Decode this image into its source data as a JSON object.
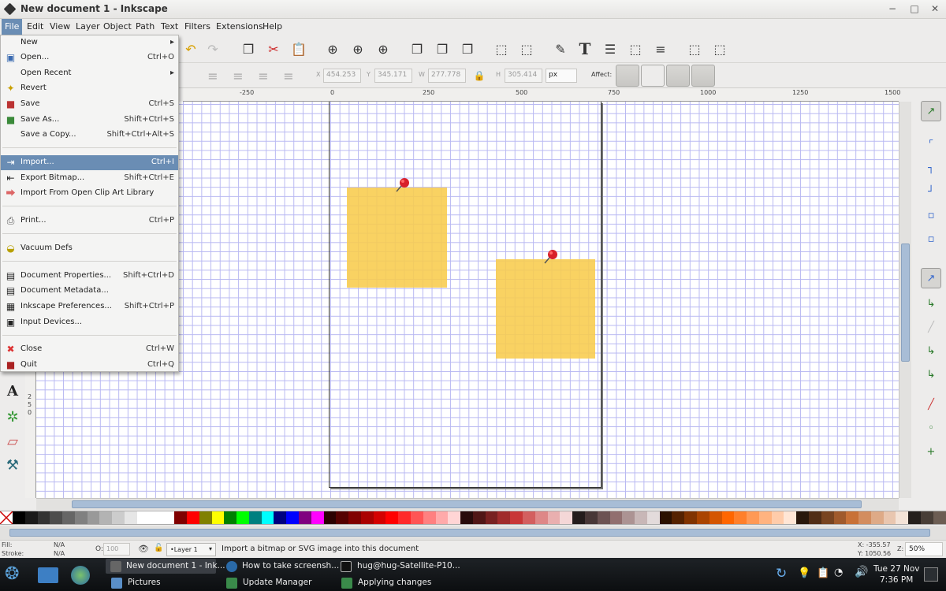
{
  "window": {
    "title": "New document 1 - Inkscape",
    "controls": [
      "−",
      "□",
      "✕"
    ]
  },
  "menubar": {
    "items": [
      "File",
      "Edit",
      "View",
      "Layer",
      "Object",
      "Path",
      "Text",
      "Filters",
      "Extensions",
      "Help"
    ]
  },
  "file_menu": {
    "items": [
      {
        "label": "New",
        "shortcut": "",
        "icon": "new-icon",
        "submenu": true
      },
      {
        "label": "Open...",
        "shortcut": "Ctrl+O",
        "icon": "open-icon"
      },
      {
        "label": "Open Recent",
        "shortcut": "",
        "icon": "",
        "submenu": true
      },
      {
        "label": "Revert",
        "shortcut": "",
        "icon": "revert-icon"
      },
      {
        "label": "Save",
        "shortcut": "Ctrl+S",
        "icon": "save-icon"
      },
      {
        "label": "Save As...",
        "shortcut": "Shift+Ctrl+S",
        "icon": "save-as-icon"
      },
      {
        "label": "Save a Copy...",
        "shortcut": "Shift+Ctrl+Alt+S",
        "icon": ""
      },
      {
        "label": "Import...",
        "shortcut": "Ctrl+I",
        "icon": "import-icon",
        "highlighted": true
      },
      {
        "label": "Export Bitmap...",
        "shortcut": "Shift+Ctrl+E",
        "icon": "export-icon"
      },
      {
        "label": "Import From Open Clip Art Library",
        "shortcut": "",
        "icon": "clipart-icon"
      },
      {
        "label": "Print...",
        "shortcut": "Ctrl+P",
        "icon": "print-icon"
      },
      {
        "label": "Vacuum Defs",
        "shortcut": "",
        "icon": "vacuum-icon"
      },
      {
        "label": "Document Properties...",
        "shortcut": "Shift+Ctrl+D",
        "icon": "document-properties-icon"
      },
      {
        "label": "Document Metadata...",
        "shortcut": "",
        "icon": "metadata-icon"
      },
      {
        "label": "Inkscape Preferences...",
        "shortcut": "Shift+Ctrl+P",
        "icon": "preferences-icon"
      },
      {
        "label": "Input Devices...",
        "shortcut": "",
        "icon": "input-devices-icon"
      },
      {
        "label": "Close",
        "shortcut": "Ctrl+W",
        "icon": "close-icon"
      },
      {
        "label": "Quit",
        "shortcut": "Ctrl+Q",
        "icon": "quit-icon"
      }
    ]
  },
  "toolbar2": {
    "x_label": "X",
    "x_value": "454.253",
    "y_label": "Y",
    "y_value": "345.171",
    "w_label": "W",
    "w_value": "277.778",
    "h_label": "H",
    "h_value": "305.414",
    "unit": "px",
    "affect_label": "Affect:"
  },
  "ruler": {
    "labels": [
      "-250",
      "0",
      "250",
      "500",
      "750",
      "1000",
      "1250",
      "1500"
    ]
  },
  "vruler": {
    "labels": [
      "2",
      "5",
      "0"
    ]
  },
  "statusbar": {
    "fill_label": "Fill:",
    "fill_value": "N/A",
    "stroke_label": "Stroke:",
    "stroke_value": "N/A",
    "opacity_label": "O:",
    "opacity_value": "100",
    "layer": "•Layer 1",
    "message": "Import a bitmap or SVG image into this document",
    "x_coord": "X: -355.57",
    "y_coord": "Y: 1050.56",
    "zoom_label": "Z:",
    "zoom": "50%"
  },
  "taskbar": {
    "windows": [
      {
        "label": "New document 1 - Ink..."
      },
      {
        "label": "How to take screensh..."
      },
      {
        "label": "hug@hug-Satellite-P10..."
      },
      {
        "label": "Pictures"
      },
      {
        "label": "Update Manager"
      },
      {
        "label": "Applying changes"
      }
    ],
    "date": "Tue 27 Nov",
    "time": "7:36 PM"
  },
  "palette": [
    "#000000",
    "#1a1a1a",
    "#333333",
    "#4d4d4d",
    "#666666",
    "#808080",
    "#999999",
    "#b3b3b3",
    "#cccccc",
    "#e6e6e6",
    "#ffffff",
    "#ffffff",
    "#ffffff",
    "#800000",
    "#ff0000",
    "#808000",
    "#ffff00",
    "#008000",
    "#00ff00",
    "#008080",
    "#00ffff",
    "#000080",
    "#0000ff",
    "#800080",
    "#ff00ff",
    "#2b0000",
    "#550000",
    "#800000",
    "#aa0000",
    "#d40000",
    "#ff0000",
    "#ff2a2a",
    "#ff5555",
    "#ff8080",
    "#ffaaaa",
    "#ffd5d5",
    "#280b0b",
    "#501616",
    "#782121",
    "#a02c2c",
    "#c83737",
    "#d35f5f",
    "#de8787",
    "#e9afaf",
    "#f4d7d7",
    "#241c1c",
    "#483737",
    "#6c5353",
    "#916f6f",
    "#ac9393",
    "#c8b7b7",
    "#e3dbdb",
    "#2b1100",
    "#552200",
    "#803300",
    "#aa4400",
    "#d45500",
    "#ff6600",
    "#ff7f2a",
    "#ff9955",
    "#ffb380",
    "#ffccaa",
    "#ffe6d5",
    "#28170b",
    "#502d16",
    "#784421",
    "#a05a2c",
    "#c87137",
    "#d38d5f",
    "#deaa87",
    "#e9c6af",
    "#f4e3d7",
    "#241f1c",
    "#483e37",
    "#6c5d53"
  ],
  "colors": {
    "accent": "#6a8db4",
    "note": "#f8cc4c",
    "pin": "#d8202a"
  }
}
